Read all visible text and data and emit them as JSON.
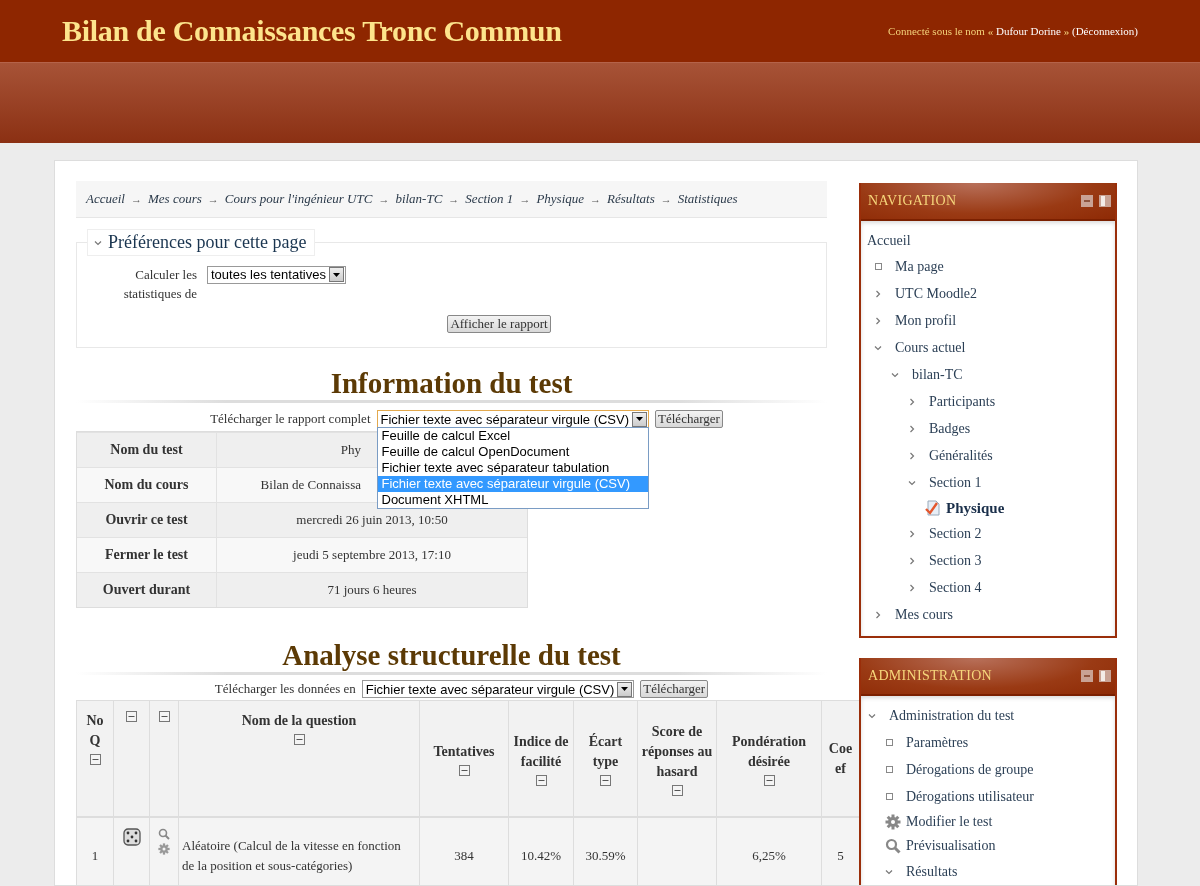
{
  "header": {
    "site_title": "Bilan de Connaissances Tronc Commun",
    "login_prefix": "Connecté sous le nom «",
    "user": "Dufour Dorine",
    "login_suffix": "»",
    "logout": "(Déconnexion)"
  },
  "breadcrumb": {
    "separator": "→",
    "items": [
      "Accueil",
      "Mes cours",
      "Cours pour l'ingénieur UTC",
      "bilan-TC",
      "Section 1",
      "Physique",
      "Résultats",
      "Statistiques"
    ]
  },
  "preferences": {
    "legend": "Préférences pour cette page",
    "expanded": true,
    "field_label": "Calculer les statistiques de",
    "select_value": "toutes les tentatives",
    "submit": "Afficher le rapport"
  },
  "info": {
    "heading": "Information du test",
    "download_label": "Télécharger le rapport complet",
    "format_value": "Fichier texte avec séparateur virgule (CSV)",
    "dropdown_open": true,
    "options": [
      {
        "label": "Feuille de calcul Excel",
        "selected": false
      },
      {
        "label": "Feuille de calcul OpenDocument",
        "selected": false
      },
      {
        "label": "Fichier texte avec séparateur tabulation",
        "selected": false
      },
      {
        "label": "Fichier texte avec séparateur virgule (CSV)",
        "selected": true
      },
      {
        "label": "Document XHTML",
        "selected": false
      }
    ],
    "download_button": "Télécharger",
    "rows": [
      {
        "label": "Nom du test",
        "value": "Phy",
        "partial": true
      },
      {
        "label": "Nom du cours",
        "value": "Bilan de Connaissa",
        "partial": true
      },
      {
        "label": "Ouvrir ce test",
        "value": "mercredi 26 juin 2013, 10:50",
        "partial": false
      },
      {
        "label": "Fermer le test",
        "value": "jeudi 5 septembre 2013, 17:10",
        "partial": false
      },
      {
        "label": "Ouvert durant",
        "value": "71 jours 6 heures",
        "partial": false
      }
    ]
  },
  "analysis": {
    "heading": "Analyse structurelle du test",
    "download_label": "Télécharger les données en",
    "format_value": "Fichier texte avec séparateur virgule (CSV)",
    "download_button": "Télécharger",
    "columns": [
      {
        "label": "No Q",
        "collapsible": true
      },
      {
        "collapsible": true
      },
      {
        "collapsible": true
      },
      {
        "label": "Nom de la question",
        "collapsible": true
      },
      {
        "label": "Tentatives",
        "collapsible": true
      },
      {
        "label": "Indice de facilité",
        "collapsible": true
      },
      {
        "label": "Écart type",
        "collapsible": true
      },
      {
        "label": "Score de réponses au hasard",
        "collapsible": true
      },
      {
        "label": "Pondération désirée",
        "collapsible": true
      },
      {
        "label": "Coe ef",
        "collapsible": false
      }
    ],
    "rows": [
      {
        "number": "1",
        "question": "Aléatoire (Calcul de la vitesse en fonction de la position et sous-catégories)",
        "attempts": "384",
        "facility": "10.42%",
        "deviation": "30.59%",
        "weight": "6,25%",
        "coef": "5"
      }
    ]
  },
  "navigation": {
    "title": "NAVIGATION",
    "items": [
      {
        "label": "Accueil",
        "kind": "root",
        "children": [
          {
            "label": "Ma page",
            "kind": "leaf"
          },
          {
            "label": "UTC Moodle2",
            "kind": "branch",
            "expanded": false
          },
          {
            "label": "Mon profil",
            "kind": "branch",
            "expanded": false
          },
          {
            "label": "Cours actuel",
            "kind": "branch",
            "expanded": true,
            "children": [
              {
                "label": "bilan-TC",
                "kind": "branch",
                "expanded": true,
                "children": [
                  {
                    "label": "Participants",
                    "kind": "branch",
                    "expanded": false
                  },
                  {
                    "label": "Badges",
                    "kind": "branch",
                    "expanded": false
                  },
                  {
                    "label": "Généralités",
                    "kind": "branch",
                    "expanded": false
                  },
                  {
                    "label": "Section 1",
                    "kind": "branch",
                    "expanded": true,
                    "children": [
                      {
                        "label": "Physique",
                        "kind": "quiz"
                      }
                    ]
                  },
                  {
                    "label": "Section 2",
                    "kind": "branch",
                    "expanded": false
                  },
                  {
                    "label": "Section 3",
                    "kind": "branch",
                    "expanded": false
                  },
                  {
                    "label": "Section 4",
                    "kind": "branch",
                    "expanded": false
                  }
                ]
              }
            ]
          },
          {
            "label": "Mes cours",
            "kind": "branch",
            "expanded": false
          }
        ]
      }
    ]
  },
  "administration": {
    "title": "ADMINISTRATION",
    "items": [
      {
        "label": "Administration du test",
        "kind": "branch",
        "expanded": true,
        "children": [
          {
            "label": "Paramètres",
            "kind": "leaf"
          },
          {
            "label": "Dérogations de groupe",
            "kind": "leaf"
          },
          {
            "label": "Dérogations utilisateur",
            "kind": "leaf"
          },
          {
            "label": "Modifier le test",
            "kind": "gear"
          },
          {
            "label": "Prévisualisation",
            "kind": "search"
          },
          {
            "label": "Résultats",
            "kind": "branch",
            "expanded": true
          }
        ]
      }
    ]
  }
}
